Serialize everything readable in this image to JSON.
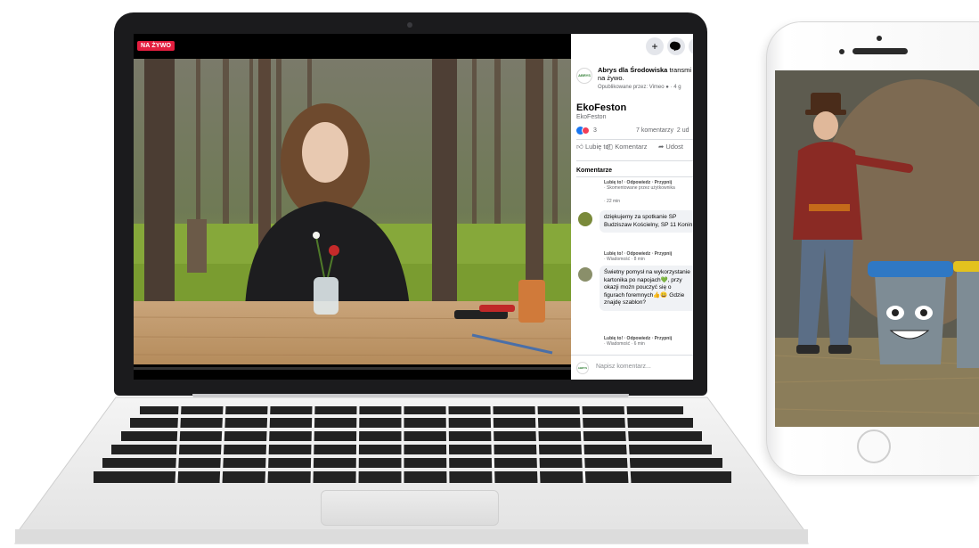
{
  "live_badge": "NA ŻYWO",
  "facebook": {
    "top_icons": [
      "plus-icon",
      "messenger-icon"
    ],
    "author_name": "Abrys dla Środowiska",
    "author_action": "transmi",
    "author_action_cont": "na żywo.",
    "posted_by": "Opublikowane przez: Vimeo",
    "posted_time": "· 4 g",
    "title": "EkoFeston",
    "subtitle": "EkoFeston",
    "reaction_count": "3",
    "comment_count": "7 komentarzy",
    "share_count": "2 ud",
    "actions": {
      "like": "Lubię to!",
      "comment": "Komentarz",
      "share": "Udost"
    },
    "comments_header": "Komentarze",
    "comments": [
      {
        "text": "",
        "meta_line1": "Lubię to! · Odpowiedz · Przypnij",
        "meta_line2": "· Skomentowane przez użytkownika",
        "meta_line3": "· 22 min"
      },
      {
        "text": "dziękujemy za spotkanie SP Budziszaw Kościelny, SP 11 Konin",
        "meta_line1": "Lubię to! · Odpowiedz · Przypnij",
        "meta_line2": "· Wiadomość · 8 min"
      },
      {
        "text": "Świetny pomysł na wykorzystanie kartonika po napojach💚, przy okazji możn pouczyć się o figurach foremnych👍😀 Gdzie znajdę szablon?",
        "meta_line1": "Lubię to! · Odpowiedz · Przypnij",
        "meta_line2": "· Wiadomość · 6 min"
      }
    ],
    "input_placeholder": "Napisz komentarz...",
    "page_avatar_text": "ABRYS"
  },
  "colors": {
    "live_red": "#e41e3f",
    "fb_blue": "#1877f2",
    "laptop_bezel": "#1b1b1d"
  }
}
